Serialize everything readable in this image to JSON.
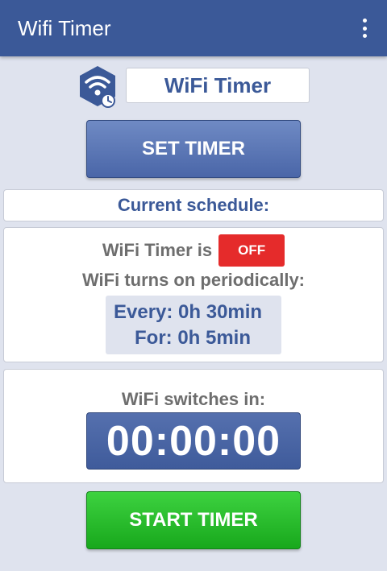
{
  "appbar": {
    "title": "Wifi Timer",
    "menu_icon": "more-vert-icon"
  },
  "header": {
    "app_icon": "wifi-clock-hexagon-icon",
    "name_value": "WiFi Timer"
  },
  "buttons": {
    "set_timer": "SET TIMER",
    "start_timer": "START TIMER"
  },
  "schedule": {
    "header": "Current schedule:",
    "status_prefix": "WiFi Timer is",
    "status_badge": "OFF",
    "periodic_text": "WiFi turns on periodically:",
    "every_text": "Every: 0h 30min",
    "for_text": "For: 0h 5min"
  },
  "countdown": {
    "label": "WiFi switches in:",
    "value": "00:00:00"
  },
  "colors": {
    "primary": "#3b5998",
    "background": "#dfe3ee",
    "off_badge": "#e52b2b",
    "start_button": "#22b526",
    "muted_text": "#6e6e6e"
  }
}
